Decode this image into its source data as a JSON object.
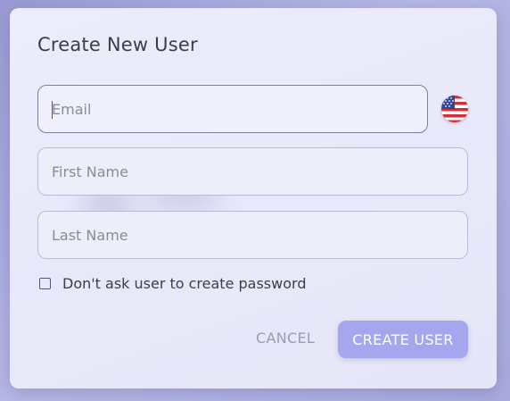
{
  "dialog": {
    "title": "Create New User",
    "email": {
      "placeholder": "Email",
      "value": ""
    },
    "country_flag": {
      "icon": "us-flag-icon"
    },
    "first_name": {
      "placeholder": "First Name",
      "value": ""
    },
    "last_name": {
      "placeholder": "Last Name",
      "value": ""
    },
    "checkbox": {
      "label": "Don't ask user to create password",
      "checked": false
    },
    "cancel_label": "CANCEL",
    "create_label": "CREATE USER"
  },
  "colors": {
    "primary_button": "#a4a7ee",
    "focused_border": "#7c7ea8",
    "field_border": "#b9b9dc"
  }
}
